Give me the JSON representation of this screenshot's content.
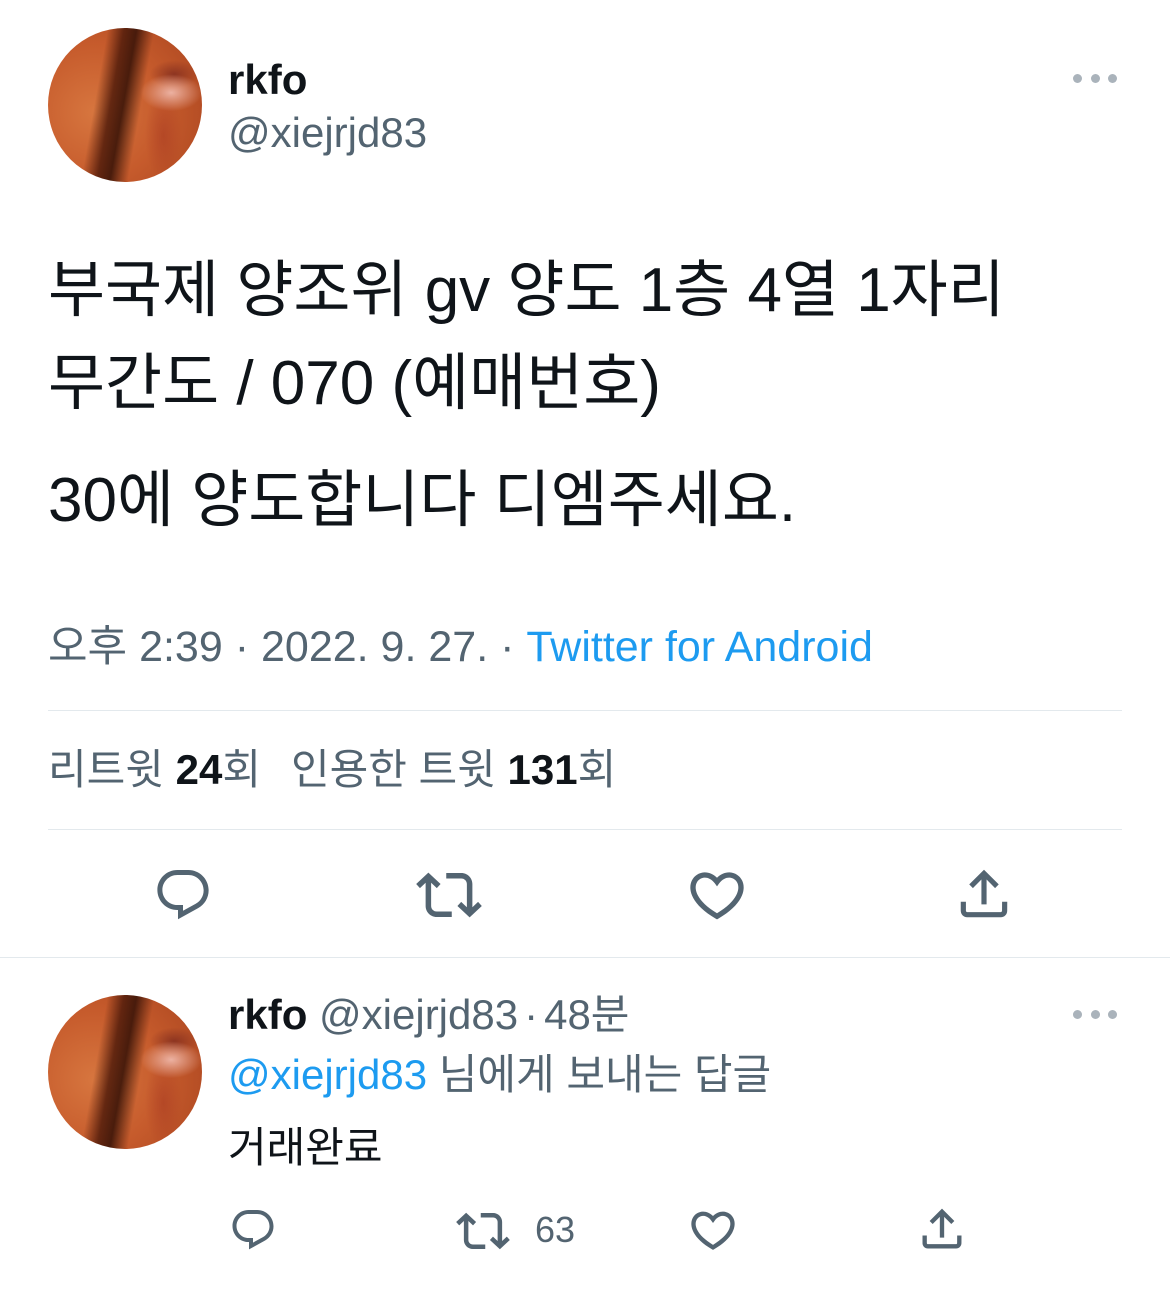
{
  "colors": {
    "text": "#0f1419",
    "secondary": "#536471",
    "accent": "#1d9bf0",
    "divider": "#e3e9ed"
  },
  "tweet": {
    "author": {
      "name": "rkfo",
      "handle": "@xiejrjd83",
      "avatar": "avatar-photo"
    },
    "more_icon": "more-horizontal-icon",
    "text": {
      "line1": "부국제 양조위 gv 양도 1층 4열 1자리",
      "line2": "무간도 / 070 (예매번호)",
      "line3": "30에 양도합니다 디엠주세요."
    },
    "time": "오후 2:39",
    "separator": "·",
    "date": "2022. 9. 27.",
    "source": "Twitter for Android",
    "stats": {
      "retweets": {
        "label": "리트윗",
        "count": "24",
        "suffix": "회"
      },
      "quotes": {
        "label": "인용한 트윗",
        "count": "131",
        "suffix": "회"
      }
    },
    "actions": {
      "reply": {
        "icon": "reply-icon"
      },
      "retweet": {
        "icon": "retweet-icon"
      },
      "like": {
        "icon": "heart-icon"
      },
      "share": {
        "icon": "share-icon"
      }
    }
  },
  "reply": {
    "author": {
      "name": "rkfo",
      "handle": "@xiejrjd83",
      "avatar": "avatar-photo"
    },
    "separator": "·",
    "age": "48분",
    "more_icon": "more-horizontal-icon",
    "replying_to": {
      "handle": "@xiejrjd83",
      "suffix": "님에게 보내는 답글"
    },
    "text": "거래완료",
    "actions": {
      "reply": {
        "icon": "reply-icon"
      },
      "retweet": {
        "icon": "retweet-icon",
        "count": "63"
      },
      "like": {
        "icon": "heart-icon"
      },
      "share": {
        "icon": "share-icon"
      }
    }
  }
}
